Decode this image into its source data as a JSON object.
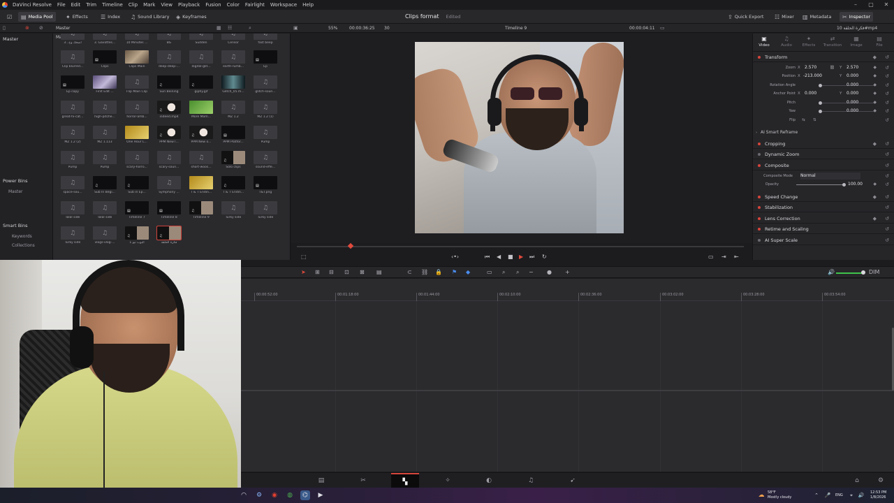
{
  "app": {
    "menu": [
      "DaVinci Resolve",
      "File",
      "Edit",
      "Trim",
      "Timeline",
      "Clip",
      "Mark",
      "View",
      "Playback",
      "Fusion",
      "Color",
      "Fairlight",
      "Workspace",
      "Help"
    ],
    "project_title": "Clips format",
    "project_status": "Edited"
  },
  "toolbar": {
    "media_pool": "Media Pool",
    "effects": "Effects",
    "index": "Index",
    "sound_library": "Sound Library",
    "keyframes": "Keyframes",
    "quick_export": "Quick Export",
    "mixer": "Mixer",
    "metadata": "Metadata",
    "inspector": "Inspector"
  },
  "subbar": {
    "zoom": "55%",
    "source_timecode": "00:00:36:25",
    "fps": "30",
    "timeline_name": "Timeline 9",
    "timecode": "00:00:04:11",
    "clip_name": "فكرة الحلقة 10#mp4"
  },
  "sidebar": {
    "master_label": "Master",
    "power_bins": "Power Bins",
    "power_master": "Master",
    "smart_bins": "Smart Bins",
    "keywords": "Keywords",
    "collections": "Collections"
  },
  "media_pool": {
    "header": "Master",
    "clips": [
      {
        "label": "اضحك وخ...3",
        "thumb": "audio"
      },
      {
        "label": "3. Gavottes...",
        "thumb": "audio"
      },
      {
        "label": "10 Minutes ...",
        "thumb": "audio"
      },
      {
        "label": "BG",
        "thumb": "audio"
      },
      {
        "label": "Sudden",
        "thumb": "audio"
      },
      {
        "label": "Censor",
        "thumb": "audio"
      },
      {
        "label": "fast beep",
        "thumb": "audio"
      },
      {
        "label": "Clip blurred...",
        "thumb": "audio"
      },
      {
        "label": "Clips",
        "thumb": "dark-tl"
      },
      {
        "label": "Clips Main",
        "thumb": "img1"
      },
      {
        "label": "deep-deep-...",
        "thumb": "audio"
      },
      {
        "label": "digital-glit...",
        "thumb": "audio"
      },
      {
        "label": "earth-rumb...",
        "thumb": "audio"
      },
      {
        "label": "Ep",
        "thumb": "dark-tl"
      },
      {
        "label": "Ep copy",
        "thumb": "dark-tl"
      },
      {
        "label": "First Edit ...",
        "thumb": "img2"
      },
      {
        "label": "Flip Main Clip",
        "thumb": "audio"
      },
      {
        "label": "Sun Beining",
        "thumb": "dark"
      },
      {
        "label": "giphy.gif",
        "thumb": "dark"
      },
      {
        "label": "Glitch_05.m...",
        "thumb": "img3"
      },
      {
        "label": "glitch-soun...",
        "thumb": "audio"
      },
      {
        "label": "great-fx-cat...",
        "thumb": "audio"
      },
      {
        "label": "high-pitche...",
        "thumb": "audio"
      },
      {
        "label": "horror-amb...",
        "thumb": "audio"
      },
      {
        "label": "indeed.mp4",
        "thumb": "flower"
      },
      {
        "label": "More Mom...",
        "thumb": "green"
      },
      {
        "label": "MZ 1.2",
        "thumb": "audio"
      },
      {
        "label": "MZ 1.2 (1)",
        "thumb": "audio"
      },
      {
        "label": "MZ 1.2 (2)",
        "thumb": "audio"
      },
      {
        "label": "MZ 1.113",
        "thumb": "audio"
      },
      {
        "label": "One Hour L...",
        "thumb": "yellow"
      },
      {
        "label": "PPM New I...",
        "thumb": "flower"
      },
      {
        "label": "PPM New o...",
        "thumb": "flower"
      },
      {
        "label": "PPM Platfor...",
        "thumb": "dark-tl"
      },
      {
        "label": "Pump",
        "thumb": "audio"
      },
      {
        "label": "Pump",
        "thumb": "audio"
      },
      {
        "label": "Pump",
        "thumb": "audio"
      },
      {
        "label": "scary-horro...",
        "thumb": "audio"
      },
      {
        "label": "scary-soun...",
        "thumb": "audio"
      },
      {
        "label": "short-woos...",
        "thumb": "audio"
      },
      {
        "label": "Solo clips",
        "thumb": "mixed"
      },
      {
        "label": "sound-effe...",
        "thumb": "audio"
      },
      {
        "label": "space-sou...",
        "thumb": "audio"
      },
      {
        "label": "Sub In Begi...",
        "thumb": "dark"
      },
      {
        "label": "Sub in Ep...",
        "thumb": "dark"
      },
      {
        "label": "Symphony ...",
        "thumb": "audio"
      },
      {
        "label": "T & T Endin...",
        "thumb": "yellow"
      },
      {
        "label": "T & T Endin...",
        "thumb": "dark"
      },
      {
        "label": "T&T.png",
        "thumb": "dark-tl"
      },
      {
        "label": "Talal side",
        "thumb": "audio"
      },
      {
        "label": "Talal side",
        "thumb": "audio"
      },
      {
        "label": "Timeline 7",
        "thumb": "dark-tl"
      },
      {
        "label": "Timeline 8",
        "thumb": "dark-tl"
      },
      {
        "label": "Timeline 9",
        "thumb": "mixed"
      },
      {
        "label": "Turky side",
        "thumb": "audio"
      },
      {
        "label": "Turky side",
        "thumb": "audio"
      },
      {
        "label": "Turky side",
        "thumb": "audio"
      },
      {
        "label": "vlogs-vlog-...",
        "thumb": "audio"
      },
      {
        "label": "البوب نيو 1",
        "thumb": "mixed"
      },
      {
        "label": "فكرة الحلقة",
        "thumb": "mixed-sel"
      }
    ]
  },
  "inspector": {
    "tabs": [
      {
        "label": "Video",
        "icon": "▣",
        "active": true
      },
      {
        "label": "Audio",
        "icon": "♫",
        "active": false
      },
      {
        "label": "Effects",
        "icon": "✦",
        "active": false
      },
      {
        "label": "Transition",
        "icon": "⇄",
        "active": false
      },
      {
        "label": "Image",
        "icon": "▦",
        "active": false
      },
      {
        "label": "File",
        "icon": "▤",
        "active": false
      }
    ],
    "transform": "Transform",
    "zoom_label": "Zoom",
    "zoom_x": "2.570",
    "zoom_y": "2.570",
    "position_label": "Position",
    "position_x": "-213.000",
    "position_y": "0.000",
    "rotation_label": "Rotation Angle",
    "rotation": "0.000",
    "anchor_label": "Anchor Point",
    "anchor_x": "0.000",
    "anchor_y": "0.000",
    "pitch_label": "Pitch",
    "pitch": "0.000",
    "yaw_label": "Yaw",
    "yaw": "0.000",
    "flip_label": "Flip",
    "ai_smart_reframe": "AI Smart Reframe",
    "cropping": "Cropping",
    "dynamic_zoom": "Dynamic Zoom",
    "composite": "Composite",
    "composite_mode_label": "Composite Mode",
    "composite_mode": "Normal",
    "opacity_label": "Opacity",
    "opacity": "100.00",
    "speed_change": "Speed Change",
    "stabilization": "Stabilization",
    "lens_correction": "Lens Correction",
    "retime_scaling": "Retime and Scaling",
    "ai_super_scale": "AI Super Scale"
  },
  "timeline": {
    "ruler": [
      "00:00:52:00",
      "00:01:18:00",
      "00:01:44:00",
      "00:02:10:00",
      "00:02:36:00",
      "00:03:02:00",
      "00:03:28:00",
      "00:03:54:00"
    ],
    "dim_label": "DIM"
  },
  "pages": [
    {
      "name": "media",
      "icon": "▤"
    },
    {
      "name": "cut",
      "icon": "✂"
    },
    {
      "name": "edit",
      "icon": "▚"
    },
    {
      "name": "fusion",
      "icon": "✧"
    },
    {
      "name": "color",
      "icon": "◐"
    },
    {
      "name": "fairlight",
      "icon": "♫"
    },
    {
      "name": "deliver",
      "icon": "➹"
    }
  ],
  "taskbar": {
    "weather_temp": "58°F",
    "weather_desc": "Mostly cloudy",
    "lang": "ENG",
    "time": "12:53 PM",
    "date": "1/8/2026"
  },
  "colors": {
    "accent": "#d6453b",
    "panel": "#2a2a2d",
    "volume": "#3fc34a"
  }
}
